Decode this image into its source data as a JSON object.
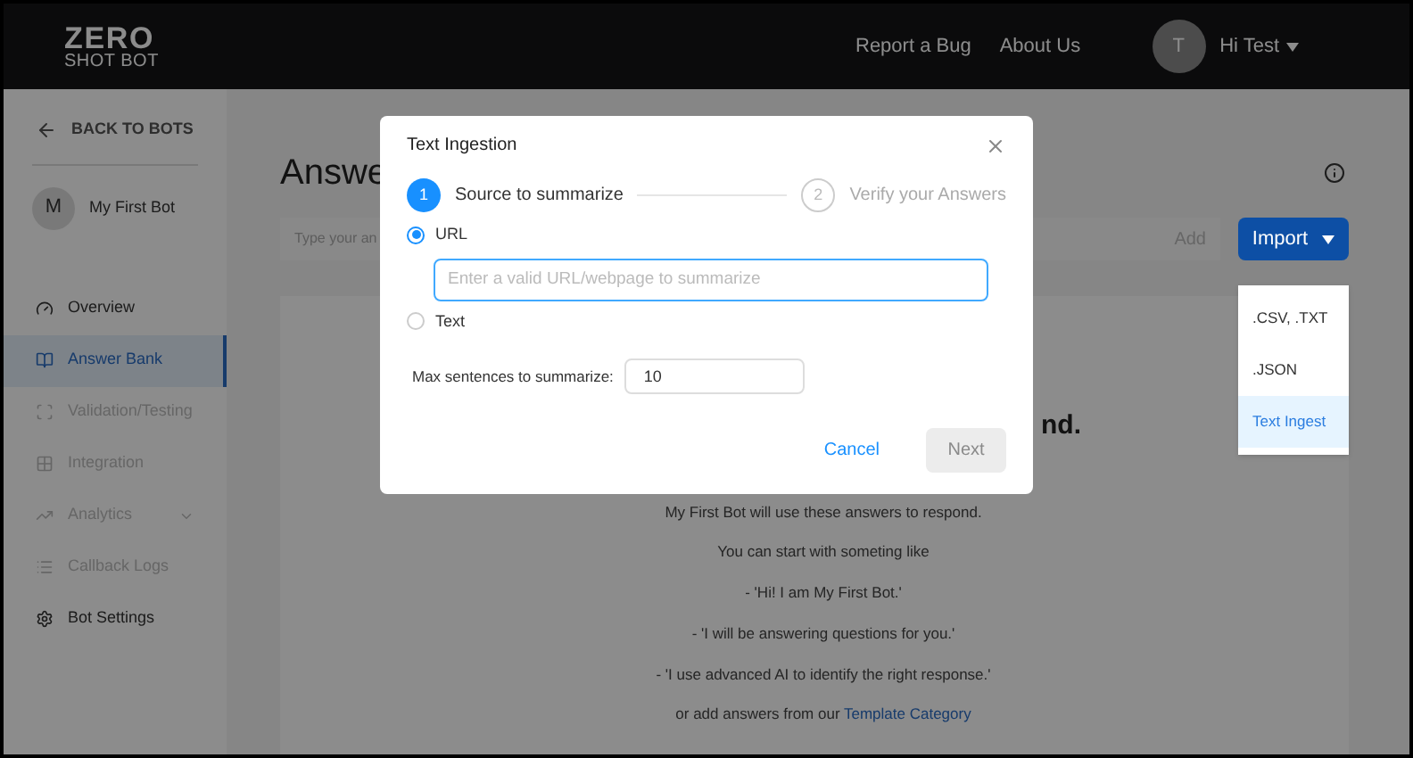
{
  "header": {
    "logo_top": "ZERO",
    "logo_bottom": "SHOT BOT",
    "links": [
      "Report a Bug",
      "About Us"
    ],
    "avatar": "T",
    "user": "Hi Test"
  },
  "sidebar": {
    "back": "BACK TO BOTS",
    "bot_avatar": "M",
    "bot_name": "My First Bot",
    "items": [
      {
        "label": "Overview",
        "kind": "gauge",
        "selected": false,
        "disabled": false,
        "has_submenu": false
      },
      {
        "label": "Answer Bank",
        "kind": "book",
        "selected": true,
        "disabled": false,
        "has_submenu": false
      },
      {
        "label": "Validation/Testing",
        "kind": "scan",
        "selected": false,
        "disabled": true,
        "has_submenu": false
      },
      {
        "label": "Integration",
        "kind": "grid",
        "selected": false,
        "disabled": true,
        "has_submenu": false
      },
      {
        "label": "Analytics",
        "kind": "chart",
        "selected": false,
        "disabled": true,
        "has_submenu": true
      },
      {
        "label": "Callback Logs",
        "kind": "list",
        "selected": false,
        "disabled": true,
        "has_submenu": false
      },
      {
        "label": "Bot Settings",
        "kind": "gear",
        "selected": false,
        "disabled": false,
        "has_submenu": false
      }
    ]
  },
  "main": {
    "title": "Answe",
    "answer_placeholder": "Type your an",
    "add": "Add",
    "import": "Import",
    "empty_heading": "nd.",
    "lines": [
      "My First Bot will use these answers to respond.",
      "You can start with someting like",
      "- 'Hi! I am My First Bot.'",
      "- 'I will be answering questions for you.'",
      "- 'I use advanced AI to identify the right response.'"
    ],
    "template_prefix": "or add answers from our",
    "template_link": "Template Category"
  },
  "import_menu": [
    {
      "label": ".CSV, .TXT",
      "selected": false
    },
    {
      "label": ".JSON",
      "selected": false
    },
    {
      "label": "Text Ingest",
      "selected": true
    }
  ],
  "dialog": {
    "title": "Text Ingestion",
    "steps": [
      {
        "number": "1",
        "label": "Source to summarize",
        "selected": true
      },
      {
        "number": "2",
        "label": "Verify your Answers",
        "selected": false
      }
    ],
    "sources": [
      {
        "label": "URL",
        "selected": true
      },
      {
        "label": "Text",
        "selected": false
      }
    ],
    "url_placeholder": "Enter a valid URL/webpage to summarize",
    "max_label": "Max sentences to summarize:",
    "max_value": "10",
    "cancel": "Cancel",
    "next": {
      "label": "Next",
      "disabled": true
    }
  }
}
